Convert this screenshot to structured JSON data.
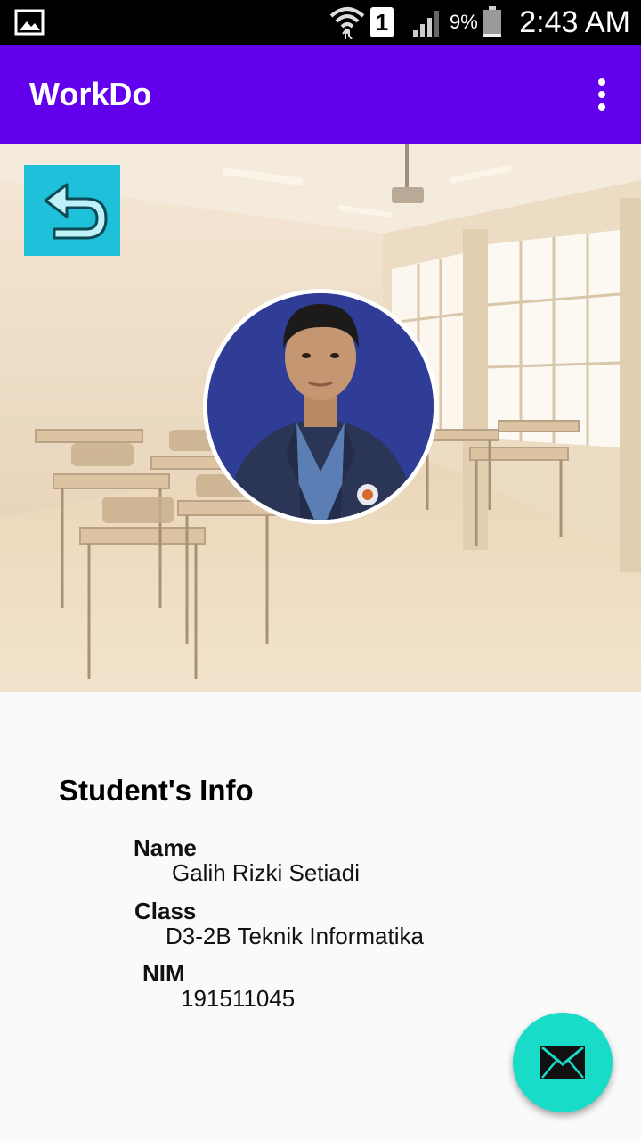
{
  "status_bar": {
    "sim_slot": "1",
    "battery_percent": "9%",
    "time": "2:43 AM",
    "icons": [
      "gallery-icon",
      "wifi-icon",
      "signal-icon",
      "battery-icon"
    ]
  },
  "app_bar": {
    "title": "WorkDo",
    "background_color": "#6200ee",
    "menu_icon": "overflow-menu-icon"
  },
  "header": {
    "background_image": "classroom",
    "back_button_icon": "back-arrow-icon",
    "back_button_color": "#1ec0da"
  },
  "student_info": {
    "heading": "Student's Info",
    "fields": [
      {
        "label": "Name",
        "value": "Galih Rizki Setiadi"
      },
      {
        "label": "Class",
        "value": "D3-2B Teknik Informatika"
      },
      {
        "label": "NIM",
        "value": "191511045"
      }
    ]
  },
  "fab": {
    "icon": "mail-icon",
    "color": "#18dcc8"
  }
}
